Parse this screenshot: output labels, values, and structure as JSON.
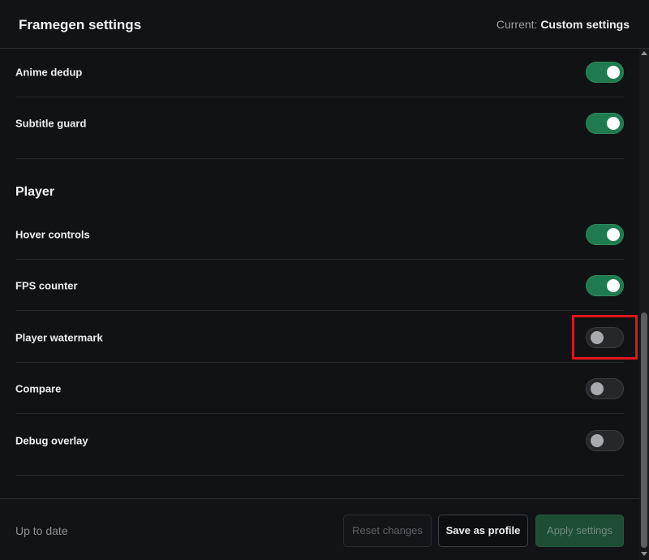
{
  "header": {
    "title": "Framegen settings",
    "current_label": "Current:",
    "current_value": "Custom settings"
  },
  "settings": {
    "anime_dedup": {
      "label": "Anime dedup",
      "enabled": true
    },
    "subtitle_guard": {
      "label": "Subtitle guard",
      "enabled": true
    }
  },
  "player": {
    "section_title": "Player",
    "hover_controls": {
      "label": "Hover controls",
      "enabled": true
    },
    "fps_counter": {
      "label": "FPS counter",
      "enabled": true
    },
    "player_watermark": {
      "label": "Player watermark",
      "enabled": false
    },
    "compare": {
      "label": "Compare",
      "enabled": false
    },
    "debug_overlay": {
      "label": "Debug overlay",
      "enabled": false
    }
  },
  "footer": {
    "status": "Up to date",
    "reset_label": "Reset changes",
    "save_label": "Save as profile",
    "apply_label": "Apply settings"
  },
  "colors": {
    "toggle_on": "#1f7a4f",
    "toggle_off": "#26272b",
    "highlight": "#e0161c"
  }
}
